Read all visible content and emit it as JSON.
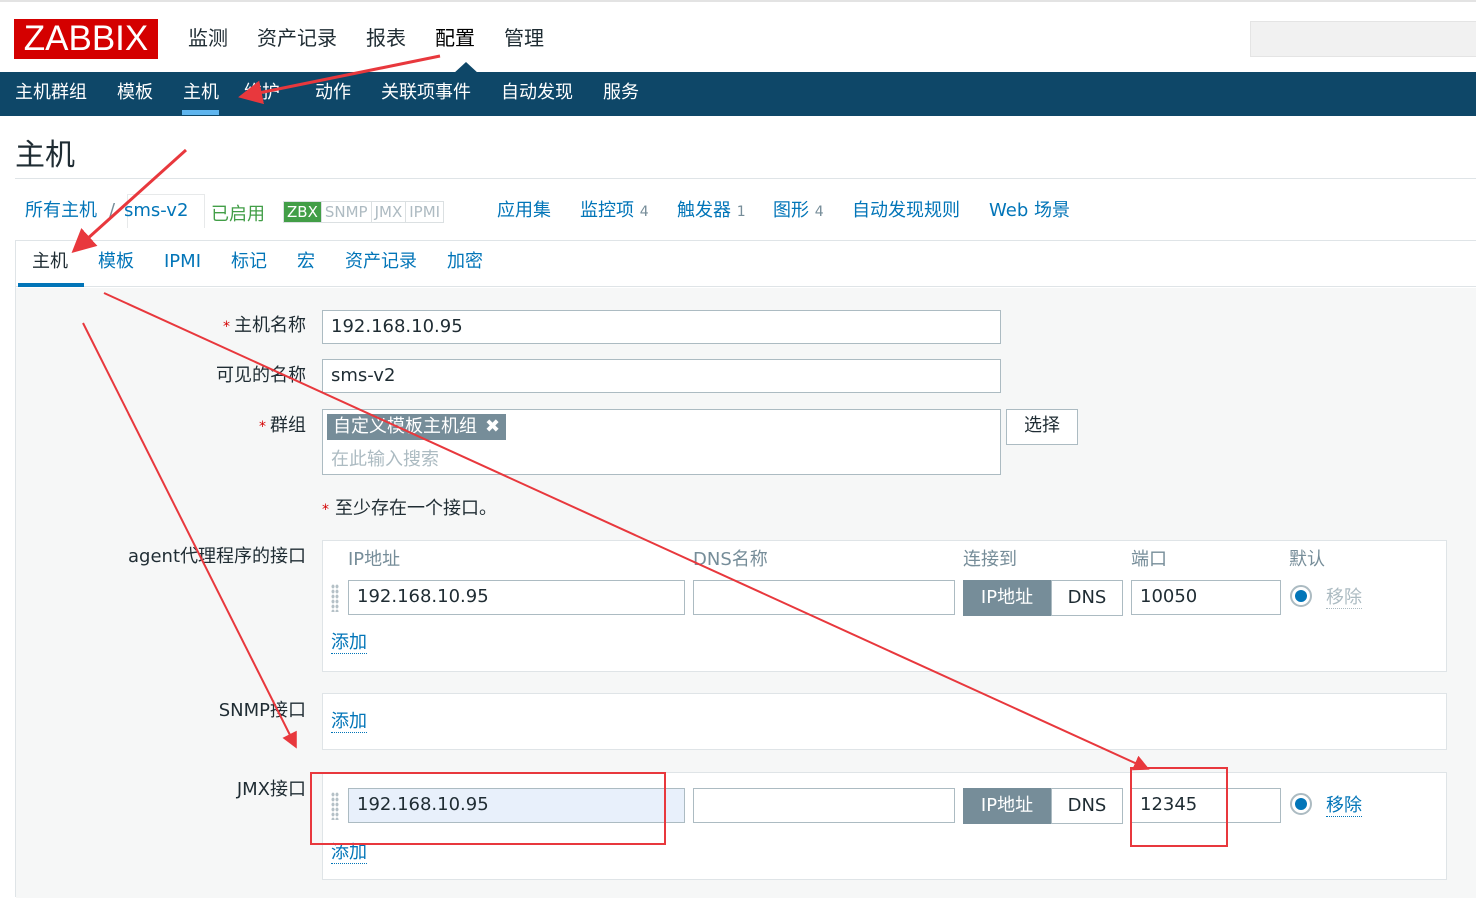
{
  "logo": "ZABBIX",
  "top_menu": [
    "监测",
    "资产记录",
    "报表",
    "配置",
    "管理"
  ],
  "sub_menu": [
    "主机群组",
    "模板",
    "主机",
    "维护",
    "动作",
    "关联项事件",
    "自动发现",
    "服务"
  ],
  "page_title": "主机",
  "host_bar": {
    "all_hosts": "所有主机",
    "separator": "/",
    "host_name": "sms-v2",
    "status": "已启用",
    "availability": [
      "ZBX",
      "SNMP",
      "JMX",
      "IPMI"
    ],
    "applications": "应用集",
    "items": "监控项",
    "items_count": "4",
    "triggers": "触发器",
    "triggers_count": "1",
    "graphs": "图形",
    "graphs_count": "4",
    "discovery_rules": "自动发现规则",
    "web_scenarios": "Web 场景"
  },
  "form_tabs": [
    "主机",
    "模板",
    "IPMI",
    "标记",
    "宏",
    "资产记录",
    "加密"
  ],
  "form": {
    "host_name_label": "主机名称",
    "host_name_value": "192.168.10.95",
    "visible_name_label": "可见的名称",
    "visible_name_value": "sms-v2",
    "groups_label": "群组",
    "group_tag": "自定义模板主机组",
    "group_tag_remove": "✖",
    "groups_placeholder": "在此输入搜索",
    "select_button": "选择",
    "interface_note": "至少存在一个接口。",
    "required_mark": "*"
  },
  "interfaces": {
    "columns": [
      "IP地址",
      "DNS名称",
      "连接到",
      "端口",
      "默认"
    ],
    "agent_label": "agent代理程序的接口",
    "agent": {
      "ip": "192.168.10.95",
      "dns": "",
      "connect_ip": "IP地址",
      "connect_dns": "DNS",
      "port": "10050",
      "remove": "移除"
    },
    "snmp_label": "SNMP接口",
    "jmx_label": "JMX接口",
    "jmx": {
      "ip": "192.168.10.95",
      "dns": "",
      "connect_ip": "IP地址",
      "connect_dns": "DNS",
      "port": "12345",
      "remove": "移除"
    },
    "add_label": "添加"
  },
  "colors": {
    "brand": "#d40000",
    "nav_bg": "#0e4768",
    "link": "#0275b8",
    "enabled": "#429e47",
    "annotation": "#e8383d"
  }
}
